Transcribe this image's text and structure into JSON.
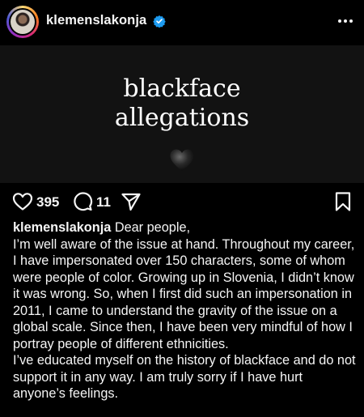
{
  "post": {
    "username": "klemenslakonja",
    "verified": true,
    "image_text_line1": "blackface",
    "image_text_line2": "allegations",
    "image_icon": "black-heart-icon",
    "likes": "395",
    "comments": "11"
  },
  "caption": {
    "username": "klemenslakonja",
    "opening": "Dear people,",
    "paragraph1": "I’m well aware of the issue at hand. Throughout my career, I have impersonated over 150 characters, some of whom were people of color. Growing up in Slovenia, I didn’t know it was wrong. So, when I first did such an impersonation in 2011, I came to understand the gravity of the issue on a global scale. Since then, I have been very mindful of how I portray people of different ethnicities.",
    "paragraph2": "I’ve educated myself on the history of blackface and do not support it in any way. I am truly sorry if I have hurt anyone’s feelings."
  },
  "colors": {
    "background": "#000000",
    "image_background": "#121212",
    "text": "#f5f5f5",
    "verified_blue": "#1d9bf0"
  },
  "icons": [
    "avatar",
    "verified-badge-icon",
    "more-options-icon",
    "heart-icon",
    "comment-icon",
    "share-icon",
    "bookmark-icon"
  ]
}
